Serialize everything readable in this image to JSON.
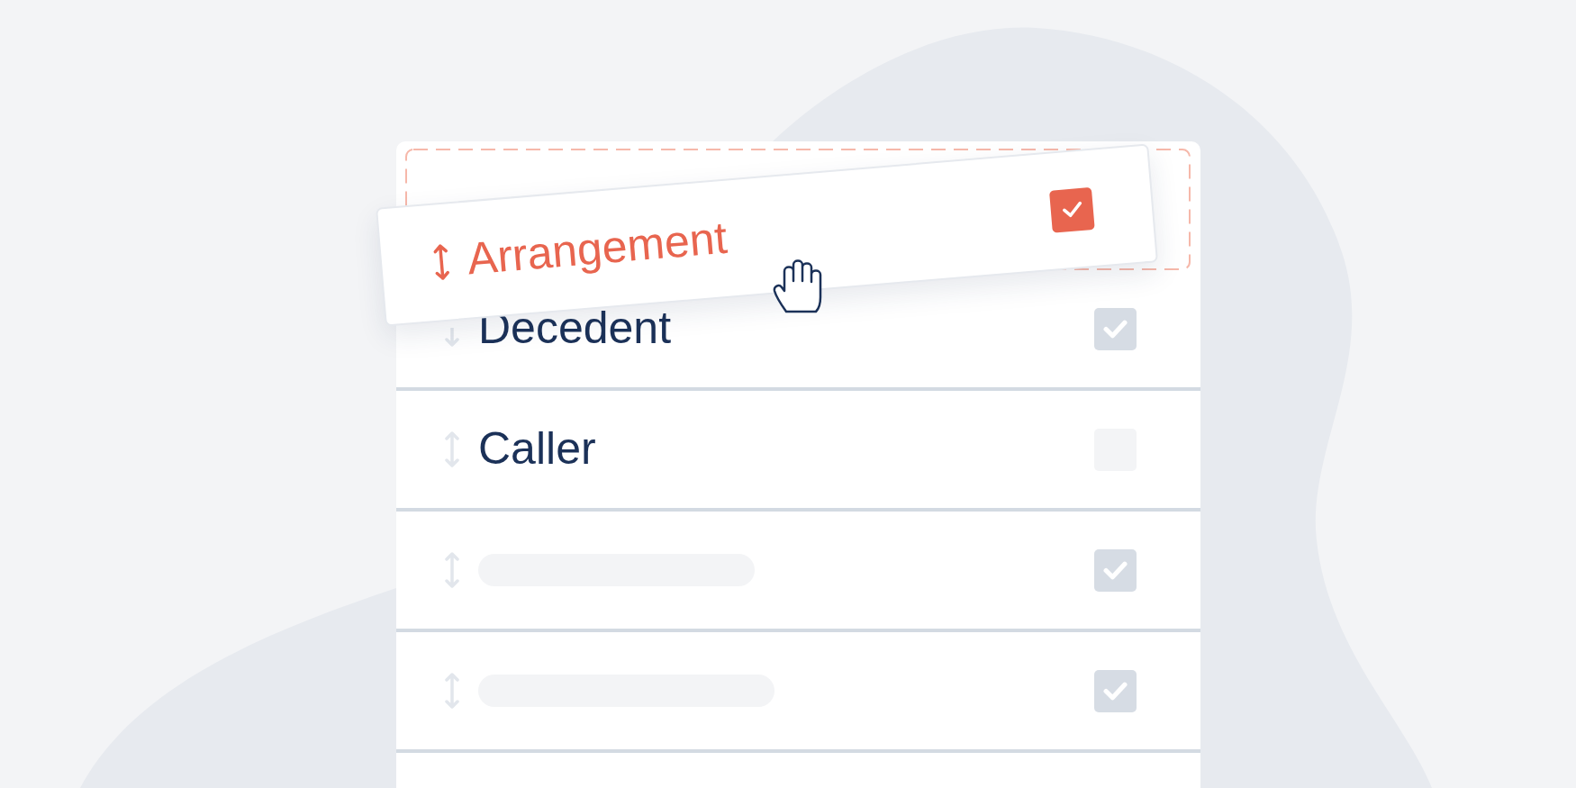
{
  "dragged_item": {
    "label": "Arrangement",
    "checked": true
  },
  "rows": [
    {
      "kind": "text",
      "label": "Decedent",
      "checked": true
    },
    {
      "kind": "text",
      "label": "Caller",
      "checked": false
    },
    {
      "kind": "skeleton",
      "checked": true
    },
    {
      "kind": "skeleton",
      "checked": true
    }
  ]
}
